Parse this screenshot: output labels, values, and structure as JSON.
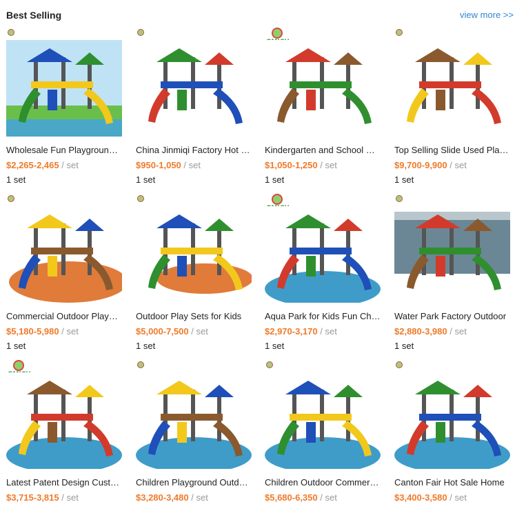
{
  "header": {
    "title": "Best Selling",
    "view_more": "view more >>"
  },
  "logo_text": "GMICH",
  "products": [
    {
      "name": "Wholesale Fun Playground Equipment",
      "price": "$2,265-2,465",
      "unit": " / set",
      "moq": "1 set",
      "logo": "small",
      "scene": "sky"
    },
    {
      "name": "China Jinmiqi Factory Hot Sale",
      "price": "$950-1,050",
      "unit": " / set",
      "moq": "1 set",
      "logo": "small",
      "scene": "white"
    },
    {
      "name": "Kindergarten and School Outdoor",
      "price": "$1,050-1,250",
      "unit": " / set",
      "moq": "1 set",
      "logo": "big",
      "scene": "white"
    },
    {
      "name": "Top Selling Slide Used Playground",
      "price": "$9,700-9,900",
      "unit": " / set",
      "moq": "1 set",
      "logo": "small",
      "scene": "white"
    },
    {
      "name": "Commercial Outdoor Playground",
      "price": "$5,180-5,980",
      "unit": " / set",
      "moq": "1 set",
      "logo": "small",
      "scene": "white"
    },
    {
      "name": "Outdoor Play Sets for Kids",
      "price": "$5,000-7,500",
      "unit": " / set",
      "moq": "1 set",
      "logo": "small",
      "scene": "white"
    },
    {
      "name": "Aqua Park for Kids Fun Cheap",
      "price": "$2,970-3,170",
      "unit": " / set",
      "moq": "1 set",
      "logo": "big",
      "scene": "water"
    },
    {
      "name": "Water Park Factory Outdoor",
      "price": "$2,880-3,980",
      "unit": " / set",
      "moq": "1 set",
      "logo": "small",
      "scene": "pool"
    },
    {
      "name": "Latest Patent Design Customized",
      "price": "$3,715-3,815",
      "unit": " / set",
      "moq": "",
      "logo": "big",
      "scene": "water"
    },
    {
      "name": "Children Playground Outdoor",
      "price": "$3,280-3,480",
      "unit": " / set",
      "moq": "",
      "logo": "small",
      "scene": "water"
    },
    {
      "name": "Children Outdoor Commercial",
      "price": "$5,680-6,350",
      "unit": " / set",
      "moq": "",
      "logo": "small",
      "scene": "water"
    },
    {
      "name": "Canton Fair Hot Sale Home",
      "price": "$3,400-3,580",
      "unit": " / set",
      "moq": "",
      "logo": "small",
      "scene": "water"
    }
  ],
  "colors": {
    "price": "#f07a2a",
    "link": "#2f86d6"
  }
}
